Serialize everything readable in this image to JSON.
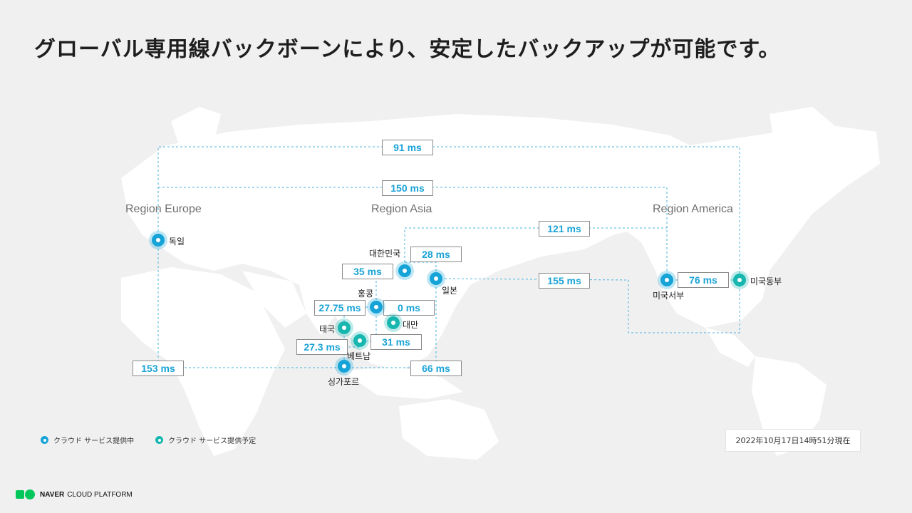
{
  "title": "グローバル専用線バックボーンにより、安定したバックアップが可能です。",
  "regions": {
    "europe": "Region Europe",
    "asia": "Region Asia",
    "america": "Region America"
  },
  "latencies": {
    "l91": "91 ms",
    "l150": "150 ms",
    "l121": "121 ms",
    "l28": "28 ms",
    "l35": "35 ms",
    "l155": "155 ms",
    "l76": "76 ms",
    "l2775": "27.75 ms",
    "l0": "0 ms",
    "l273": "27.3 ms",
    "l31": "31 ms",
    "l153": "153 ms",
    "l66": "66 ms"
  },
  "cities": {
    "germany": "독일",
    "korea": "대한민국",
    "japan": "일본",
    "hongkong": "홍콩",
    "taiwan": "대만",
    "thailand": "태국",
    "vietnam": "베트남",
    "singapore": "싱가포르",
    "us_west": "미국서부",
    "us_east": "미국동부"
  },
  "legend": {
    "active": "クラウド サービス提供中",
    "planned": "クラウド サービス提供予定"
  },
  "timestamp": "2022年10月17日14時51分現在",
  "footer": {
    "brand": "NAVER",
    "product": "CLOUD PLATFORM"
  },
  "colors": {
    "active": "#16a4d8",
    "planned": "#17b7b0",
    "brand": "#03c75a",
    "latency_text": "#1aa3d6",
    "dashed_line": "#4ab3e0"
  }
}
